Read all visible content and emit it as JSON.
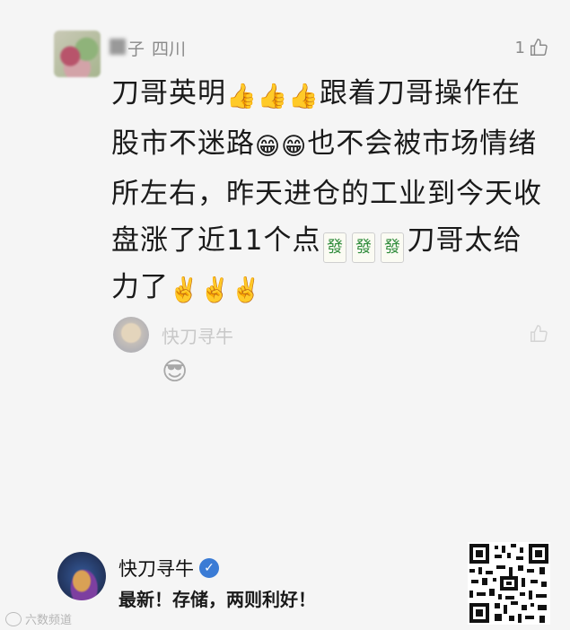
{
  "comment": {
    "user_name_suffix": "子",
    "location": "四川",
    "like_count": "1",
    "lines": [
      {
        "text": "刀哥英明",
        "emoji": [
          "👍",
          "👍",
          "👍"
        ],
        "tail": "跟着刀哥操作在"
      },
      {
        "text": "股市不迷路",
        "emoji": [
          "😁",
          "😁"
        ],
        "tail": "也不会被市场情绪"
      },
      {
        "text": "所左右，昨天进仓的工业到今天收",
        "emoji": [],
        "tail": ""
      },
      {
        "text": "盘涨了近11个点",
        "mahjong": [
          "發",
          "發",
          "發"
        ],
        "tail": "刀哥太给"
      },
      {
        "text": "力了",
        "emoji": [
          "✌️",
          "✌️",
          "✌️"
        ],
        "tail": ""
      }
    ]
  },
  "reply": {
    "author_name": "快刀寻牛",
    "emoji": "😎"
  },
  "footer": {
    "author_name": "快刀寻牛",
    "post_title": "最新！存储，两则利好！",
    "watermark": "六数频道"
  },
  "colors": {
    "background": "#f5f5f5",
    "verified": "#3a7bd5",
    "mahjong_green": "#2e8b3a"
  }
}
